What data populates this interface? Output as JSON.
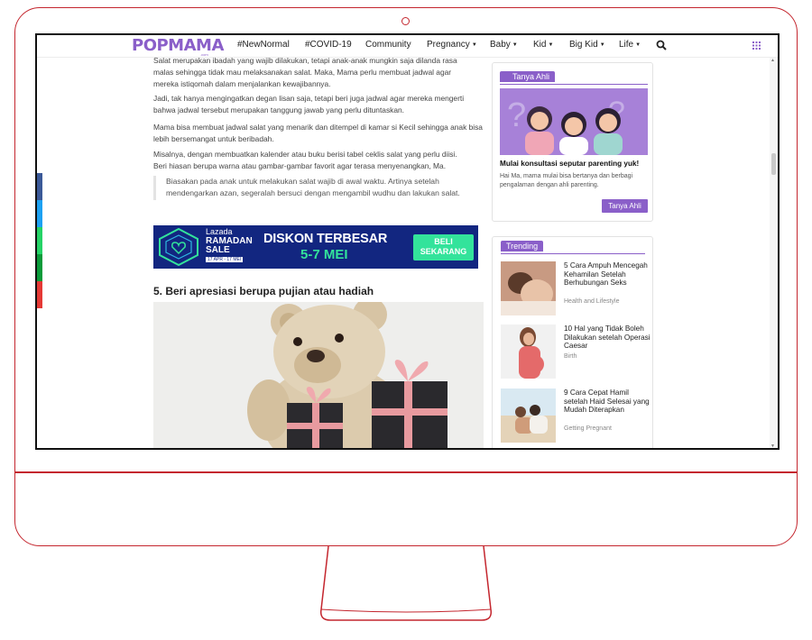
{
  "nav": {
    "logo": "POPMAMA",
    "logo_sub": ".com",
    "items": [
      {
        "label": "#NewNormal",
        "dropdown": false
      },
      {
        "label": "#COVID-19",
        "dropdown": false
      },
      {
        "label": "Community",
        "dropdown": false
      },
      {
        "label": "Pregnancy",
        "dropdown": true
      },
      {
        "label": "Baby",
        "dropdown": true
      },
      {
        "label": "Kid",
        "dropdown": true
      },
      {
        "label": "Big Kid",
        "dropdown": true
      },
      {
        "label": "Life",
        "dropdown": true
      }
    ],
    "search_icon": "search-icon",
    "menu_icon": "grid-menu-icon"
  },
  "article": {
    "paragraphs": [
      "Salat merupakan ibadah yang wajib dilakukan, tetapi anak-anak mungkin saja dilanda rasa malas sehingga tidak mau melaksanakan salat. Maka, Mama perlu membuat jadwal agar mereka istiqomah dalam menjalankan kewajibannya.",
      "Jadi, tak hanya mengingatkan degan lisan saja, tetapi beri juga jadwal agar mereka mengerti bahwa jadwal tersebut merupakan tanggung jawab yang perlu dituntaskan.",
      "Mama bisa membuat jadwal salat yang menarik dan ditempel di kamar si Kecil sehingga anak bisa lebih bersemangat untuk beribadah.",
      "Misalnya, dengan membuatkan kalender atau buku berisi tabel ceklis salat yang perlu diisi. Beri hiasan berupa warna atau gambar-gambar favorit agar terasa menyenangkan, Ma."
    ],
    "quote": "Biasakan pada anak untuk melakukan salat wajib di awal waktu. Artinya setelah mendengarkan azan, segeralah bersuci dengan mengambil wudhu dan lakukan salat.",
    "banner": {
      "brand": "Lazada",
      "sale_line1": "RAMADAN",
      "sale_line2": "SALE",
      "dates": "17 APR - 17 MEI",
      "headline": "DISKON TERBESAR",
      "date_big": "5-7 MEI",
      "cta_line1": "BELI",
      "cta_line2": "SEKARANG"
    },
    "section_title": "5. Beri apresiasi berupa pujian atau hadiah"
  },
  "sidebar": {
    "tanya": {
      "label": "Tanya Ahli",
      "heading": "Mulai konsultasi seputar parenting yuk!",
      "desc": "Hai Ma, mama mulai bisa bertanya dan berbagi pengalaman dengan ahli parenting.",
      "button": "Tanya Ahli"
    },
    "trending": {
      "label": "Trending",
      "items": [
        {
          "title": "5 Cara Ampuh Mencegah Kehamilan Setelah Berhubungan Seks",
          "category": "Health and Lifestyle"
        },
        {
          "title": "10 Hal yang Tidak Boleh Dilakukan setelah Operasi Caesar",
          "category": "Birth"
        },
        {
          "title": "9 Cara Cepat Hamil setelah Haid Selesai yang Mudah Diterapkan",
          "category": "Getting Pregnant"
        }
      ]
    }
  },
  "colors": {
    "brand": "#8a5fc9",
    "frame": "#c4262e",
    "banner_bg": "#122680",
    "banner_accent": "#33e39b"
  }
}
